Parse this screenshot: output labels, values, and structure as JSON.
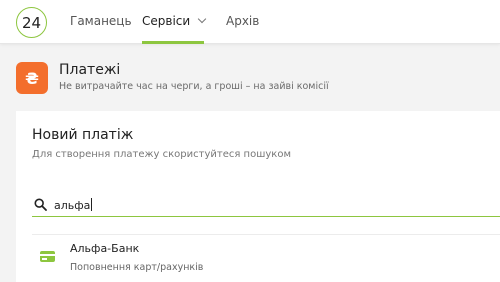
{
  "header": {
    "logo_text": "24",
    "nav": [
      {
        "label": "Гаманець"
      },
      {
        "label": "Сервіси"
      },
      {
        "label": "Архів"
      }
    ],
    "active_tab_color": "#8dc63f"
  },
  "payments": {
    "icon_symbol": "₴",
    "icon_color": "#f36e2c",
    "title": "Платежі",
    "subtitle": "Не витрачайте час на черги, а гроші – на зайві комісії"
  },
  "new_payment": {
    "title": "Новий платіж",
    "subtitle": "Для створення платежу скористуйтеся пошуком",
    "search_value": "альфа"
  },
  "results": [
    {
      "icon": "card-icon",
      "title": "Альфа-Банк",
      "subtitle": "Поповнення карт/рахунків"
    }
  ]
}
